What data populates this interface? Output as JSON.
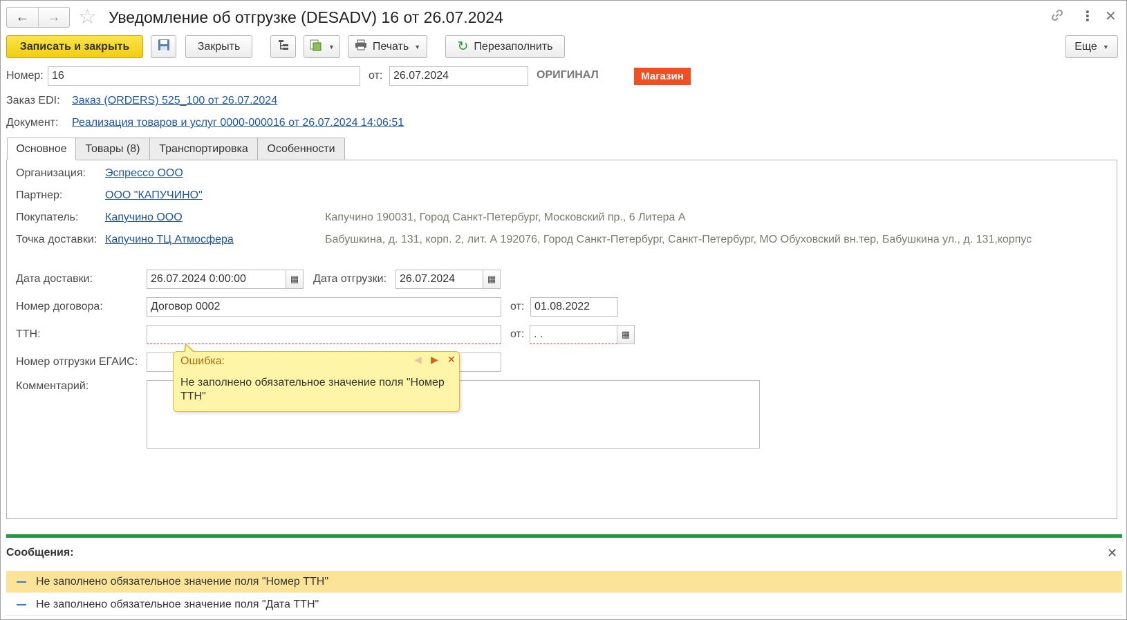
{
  "window": {
    "title": "Уведомление об отгрузке (DESADV) 16 от 26.07.2024",
    "icons": [
      "back-arrow-icon",
      "forward-arrow-icon",
      "star-icon",
      "link-icon",
      "more-vertical-icon",
      "close-icon"
    ]
  },
  "toolbar": {
    "save_close": "Записать и закрыть",
    "close": "Закрыть",
    "print": "Печать",
    "refill": "Перезаполнить",
    "more": "Еще"
  },
  "header": {
    "number_label": "Номер:",
    "number_value": "16",
    "date_label": "от:",
    "date_value": "26.07.2024",
    "original": "ОРИГИНАЛ",
    "badge": "Магазин",
    "edi_label": "Заказ EDI:",
    "edi_link": "Заказ (ORDERS) 525_100 от 26.07.2024",
    "doc_label": "Документ:",
    "doc_link": "Реализация товаров и услуг 0000-000016 от 26.07.2024 14:06:51"
  },
  "tabs": [
    {
      "label": "Основное"
    },
    {
      "label": "Товары (8)"
    },
    {
      "label": "Транспортировка"
    },
    {
      "label": "Особенности"
    }
  ],
  "main": {
    "org_label": "Организация:",
    "org_value": "Эспрессо ООО",
    "partner_label": "Партнер:",
    "partner_value": "ООО \"КАПУЧИНО\"",
    "buyer_label": "Покупатель:",
    "buyer_value": "Капучино ООО",
    "buyer_address": "Капучино 190031, Город Санкт-Петербург, Московский пр., 6 Литера А",
    "delivery_point_label": "Точка доставки:",
    "delivery_point_value": "Капучино ТЦ Атмосфера",
    "delivery_point_address": "Бабушкина, д. 131, корп. 2, лит. А 192076, Город Санкт-Петербург, Санкт-Петербург, МО Обуховский вн.тер, Бабушкина ул., д. 131,корпус",
    "delivery_date_label": "Дата доставки:",
    "delivery_date_value": "26.07.2024  0:00:00",
    "ship_date_label": "Дата отгрузки:",
    "ship_date_value": "26.07.2024",
    "contract_label": "Номер договора:",
    "contract_value": "Договор 0002",
    "contract_date_label": "от:",
    "contract_date_value": "01.08.2022",
    "ttn_label": "ТТН:",
    "ttn_value": "",
    "ttn_date_label": "от:",
    "ttn_date_value": "  .  .",
    "egais_label": "Номер отгрузки ЕГАИС:",
    "egais_value": "",
    "comment_label": "Комментарий:",
    "comment_value": ""
  },
  "tooltip": {
    "title": "Ошибка:",
    "text": "Не заполнено обязательное значение поля \"Номер ТТН\""
  },
  "messages": {
    "title": "Сообщения:",
    "items": [
      {
        "text": "Не заполнено обязательное значение поля \"Номер ТТН\""
      },
      {
        "text": "Не заполнено обязательное значение поля \"Дата ТТН\""
      }
    ]
  },
  "colors": {
    "primary_button": "#f5d327",
    "badge": "#f04e23",
    "link": "#1d55a6",
    "green_bar": "#1a9b3e",
    "selected_message": "#fbe498",
    "tooltip_bg": "#fff5a8"
  }
}
